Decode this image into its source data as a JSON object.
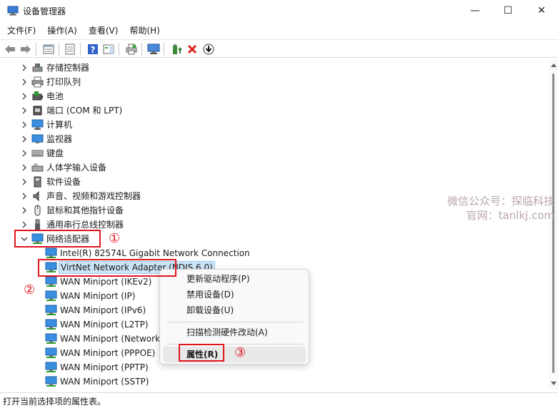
{
  "window": {
    "title": "设备管理器",
    "minimize_glyph": "—",
    "maximize_glyph": "☐",
    "close_glyph": "✕"
  },
  "menu": [
    "文件(F)",
    "操作(A)",
    "查看(V)",
    "帮助(H)"
  ],
  "toolbar": [
    "back-icon",
    "forward-icon",
    "properties-sheet-icon",
    "console-icon",
    "help-icon",
    "action-pane-icon",
    "print-icon",
    "scan-hardware-icon",
    "update-driver-icon",
    "uninstall-icon",
    "download-icon"
  ],
  "tree": {
    "categories": [
      {
        "label": "存储控制器",
        "icon": "storage-controller-icon"
      },
      {
        "label": "打印队列",
        "icon": "printer-icon"
      },
      {
        "label": "电池",
        "icon": "battery-icon"
      },
      {
        "label": "端口 (COM 和 LPT)",
        "icon": "port-icon"
      },
      {
        "label": "计算机",
        "icon": "computer-icon"
      },
      {
        "label": "监视器",
        "icon": "monitor-icon"
      },
      {
        "label": "键盘",
        "icon": "keyboard-icon"
      },
      {
        "label": "人体学输入设备",
        "icon": "hid-icon"
      },
      {
        "label": "软件设备",
        "icon": "software-device-icon"
      },
      {
        "label": "声音、视频和游戏控制器",
        "icon": "sound-icon"
      },
      {
        "label": "鼠标和其他指针设备",
        "icon": "mouse-icon"
      },
      {
        "label": "通用串行总线控制器",
        "icon": "usb-icon"
      }
    ],
    "network_category": "网络适配器",
    "adapters": [
      "Intel(R) 82574L Gigabit Network Connection",
      "VirtNet Network Adapter (NDIS 6.0)",
      "WAN Miniport (IKEv2)",
      "WAN Miniport (IP)",
      "WAN Miniport (IPv6)",
      "WAN Miniport (L2TP)",
      "WAN Miniport (Network Monitor)",
      "WAN Miniport (PPPOE)",
      "WAN Miniport (PPTP)",
      "WAN Miniport (SSTP)"
    ]
  },
  "context_menu": {
    "update_driver": "更新驱动程序(P)",
    "disable": "禁用设备(D)",
    "uninstall": "卸载设备(U)",
    "scan": "扫描检测硬件改动(A)",
    "properties": "属性(R)"
  },
  "annotations": {
    "step1": "①",
    "step2": "②",
    "step3": "③",
    "highlight_color": "#e0141e"
  },
  "watermark": {
    "line1": "微信公众号：探临科技",
    "line2": "官网：tanlkj.com"
  },
  "status": "打开当前选择项的属性表。"
}
